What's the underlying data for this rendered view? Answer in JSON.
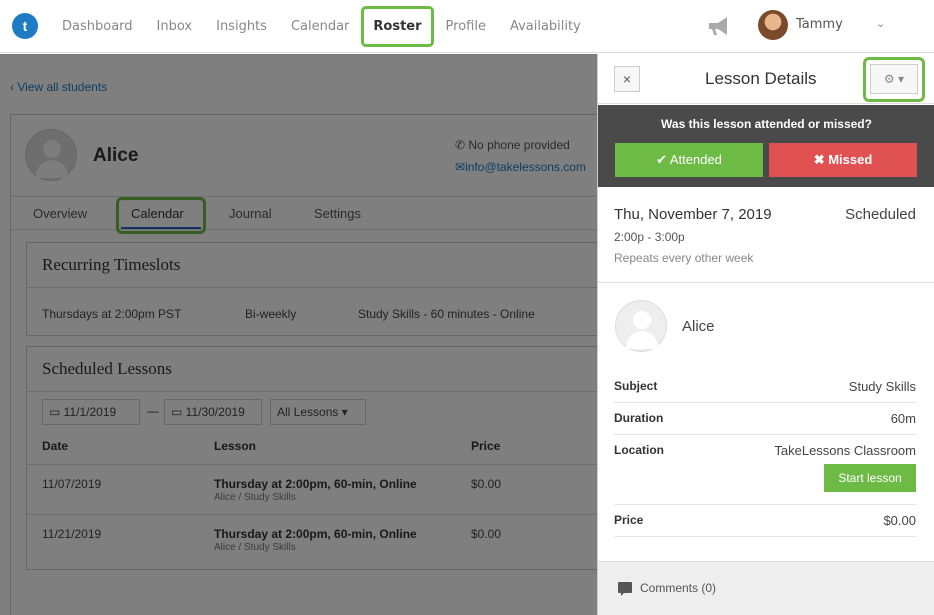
{
  "nav": {
    "items": [
      {
        "label": "Dashboard"
      },
      {
        "label": "Inbox"
      },
      {
        "label": "Insights"
      },
      {
        "label": "Calendar"
      },
      {
        "label": "Roster"
      },
      {
        "label": "Profile"
      },
      {
        "label": "Availability"
      }
    ],
    "active": "Roster",
    "user_name": "Tammy"
  },
  "main": {
    "back_link": "‹ View all students",
    "student_name": "Alice",
    "phone": "No phone provided",
    "email": "info@takelessons.com",
    "tabs": [
      {
        "label": "Overview"
      },
      {
        "label": "Calendar"
      },
      {
        "label": "Journal"
      },
      {
        "label": "Settings"
      }
    ],
    "recurring": {
      "title": "Recurring Timeslots",
      "day_time": "Thursdays at 2:00pm PST",
      "frequency": "Bi-weekly",
      "subject": "Study Skills - 60 minutes - Online"
    },
    "scheduled": {
      "title": "Scheduled Lessons",
      "from_date": "11/1/2019",
      "to_date": "11/30/2019",
      "dash": "—",
      "filter": "All Lessons",
      "columns": [
        "Date",
        "Lesson",
        "Price"
      ],
      "rows": [
        {
          "date": "11/07/2019",
          "lesson": "Thursday at 2:00pm, 60-min, Online",
          "sub": "Alice / Study Skills",
          "price": "$0.00"
        },
        {
          "date": "11/21/2019",
          "lesson": "Thursday at 2:00pm, 60-min, Online",
          "sub": "Alice / Study Skills",
          "price": "$0.00"
        }
      ]
    }
  },
  "drawer": {
    "title": "Lesson Details",
    "close_label": "×",
    "attend_question": "Was this lesson attended or missed?",
    "attended_label": "✔ Attended",
    "missed_label": "✖ Missed",
    "date": "Thu, November 7, 2019",
    "status": "Scheduled",
    "time": "2:00p - 3:00p",
    "repeat": "Repeats every other week",
    "student_name": "Alice",
    "details": [
      {
        "label": "Subject",
        "value": "Study Skills"
      },
      {
        "label": "Duration",
        "value": "60m"
      },
      {
        "label": "Location",
        "value": "TakeLessons Classroom"
      },
      {
        "label": "Price",
        "value": "$0.00"
      }
    ],
    "start_lesson_label": "Start lesson",
    "comments_label": "Comments (0)"
  },
  "colors": {
    "brand_blue": "#1f7bc4",
    "green": "#6dbb45",
    "red": "#e05252",
    "highlight": "#6dbb45"
  }
}
